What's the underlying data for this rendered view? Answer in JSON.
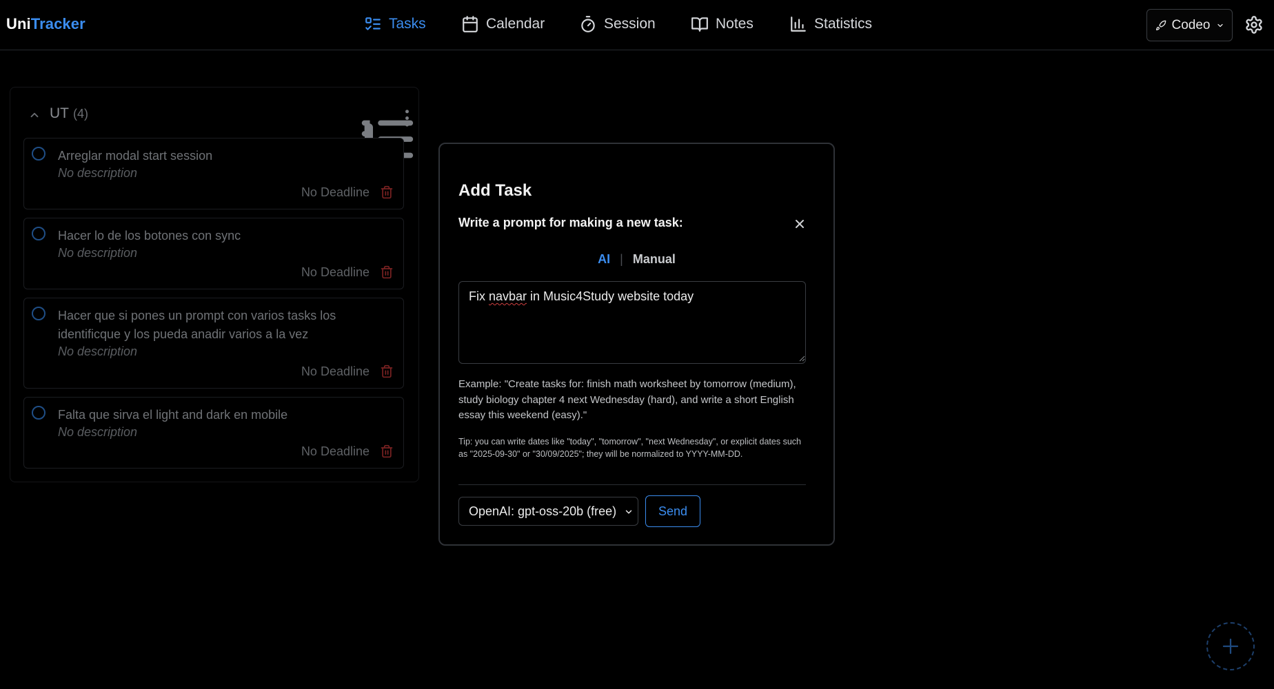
{
  "brand": {
    "part1": "Uni",
    "part2": "Tracker"
  },
  "nav": {
    "items": [
      {
        "label": "Tasks",
        "icon": "tasks-list-icon",
        "active": true
      },
      {
        "label": "Calendar",
        "icon": "calendar-icon",
        "active": false
      },
      {
        "label": "Session",
        "icon": "stopwatch-icon",
        "active": false
      },
      {
        "label": "Notes",
        "icon": "book-icon",
        "active": false
      },
      {
        "label": "Statistics",
        "icon": "bar-chart-icon",
        "active": false
      }
    ]
  },
  "workspace": {
    "label": "Codeo",
    "icon": "rocket-icon"
  },
  "settings": {
    "icon": "gear-icon"
  },
  "group": {
    "title": "UT",
    "count": "(4)",
    "tasks": [
      {
        "title": "Arreglar modal start session",
        "description": "No description",
        "deadline": "No Deadline"
      },
      {
        "title": "Hacer lo de los botones con sync",
        "description": "No description",
        "deadline": "No Deadline"
      },
      {
        "title": "Hacer que si pones un prompt con varios tasks los identificque y los pueda anadir varios a la vez",
        "description": "No description",
        "deadline": "No Deadline"
      },
      {
        "title": "Falta que sirva el light and dark en mobile",
        "description": "No description",
        "deadline": "No Deadline"
      }
    ]
  },
  "modal": {
    "title": "Add Task",
    "subtitle": "Write a prompt for making a new task:",
    "mode_ai": "AI",
    "mode_separator": "|",
    "mode_manual": "Manual",
    "prompt_before": "Fix ",
    "prompt_misspelled": "navbar",
    "prompt_after": " in Music4Study website today",
    "example": "Example: \"Create tasks for: finish math worksheet by tomorrow (medium), study biology chapter 4 next Wednesday (hard), and write a short English essay this weekend (easy).\"",
    "tip": "Tip: you can write dates like \"today\", \"tomorrow\", \"next Wednesday\", or explicit dates such as \"2025-09-30\" or \"30/09/2025\"; they will be normalized to YYYY-MM-DD.",
    "model": "OpenAI: gpt-oss-20b (free)",
    "send_label": "Send"
  },
  "colors": {
    "accent": "#3b8df0",
    "danger": "#7a2222",
    "background": "#000000"
  }
}
